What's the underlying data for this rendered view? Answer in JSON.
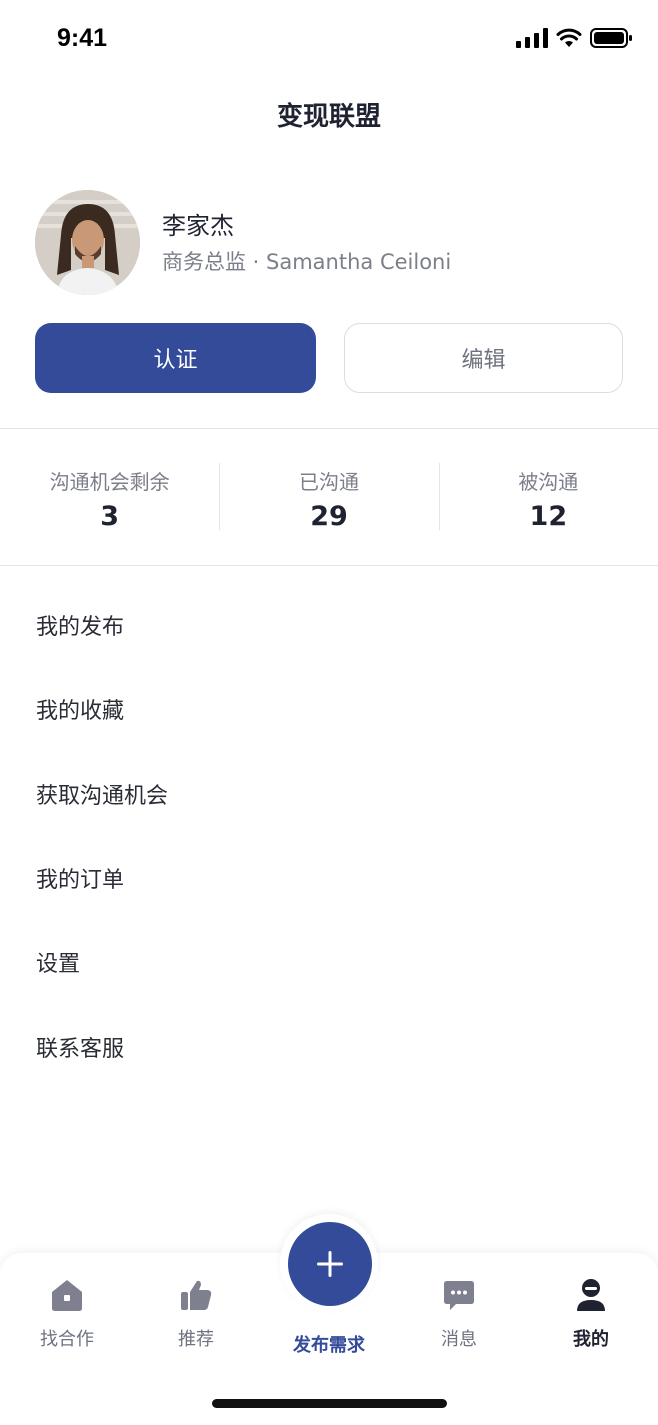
{
  "status_bar": {
    "time": "9:41"
  },
  "nav": {
    "title": "变现联盟"
  },
  "profile": {
    "name": "李家杰",
    "subtitle": "商务总监 · Samantha Ceiloni"
  },
  "actions": {
    "verify_label": "认证",
    "edit_label": "编辑"
  },
  "stats": [
    {
      "label": "沟通机会剩余",
      "value": "3"
    },
    {
      "label": "已沟通",
      "value": "29"
    },
    {
      "label": "被沟通",
      "value": "12"
    }
  ],
  "menu": [
    {
      "label": "我的发布"
    },
    {
      "label": "我的收藏"
    },
    {
      "label": "获取沟通机会"
    },
    {
      "label": "我的订单"
    },
    {
      "label": "设置"
    },
    {
      "label": "联系客服"
    }
  ],
  "tabbar": {
    "items": [
      {
        "label": "找合作",
        "icon": "home-icon"
      },
      {
        "label": "推荐",
        "icon": "thumbs-up-icon"
      },
      {
        "label": "发布需求",
        "icon": "plus-icon"
      },
      {
        "label": "消息",
        "icon": "message-icon"
      },
      {
        "label": "我的",
        "icon": "person-icon"
      }
    ],
    "active_index": 4
  },
  "colors": {
    "primary": "#344b9a",
    "text": "#1f2230",
    "muted": "#7c7f8a"
  }
}
